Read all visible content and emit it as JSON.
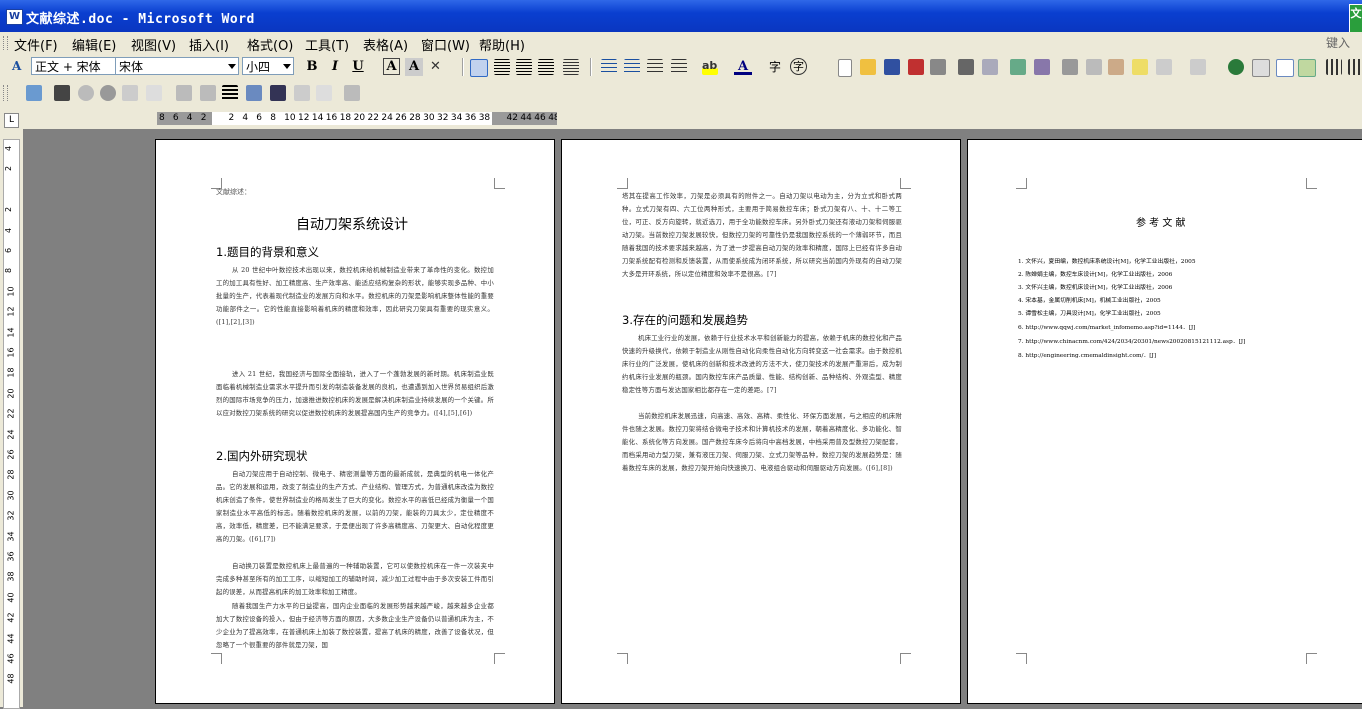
{
  "window": {
    "title": "文献综述.doc - Microsoft Word",
    "icon": "word-document-icon",
    "corner_button": "文"
  },
  "menu": {
    "items": [
      "文件(F)",
      "编辑(E)",
      "视图(V)",
      "插入(I)",
      "格式(O)",
      "工具(T)",
      "表格(A)",
      "窗口(W)",
      "帮助(H)"
    ],
    "hint": "键入"
  },
  "formatting": {
    "style": "正文 + 宋体",
    "font": "宋体",
    "size": "小四",
    "bold": "B",
    "italic": "I",
    "underline": "U",
    "char_border": "A",
    "font_color": "A",
    "phonetic": "字",
    "encircle": "字"
  },
  "ruler": {
    "marks": [
      "8",
      "6",
      "4",
      "2",
      "",
      "2",
      "4",
      "6",
      "8",
      "10",
      "12",
      "14",
      "16",
      "18",
      "20",
      "22",
      "24",
      "26",
      "28",
      "30",
      "32",
      "34",
      "36",
      "38",
      "",
      "42",
      "44",
      "46",
      "48"
    ],
    "tab_selector": "L",
    "vertical_marks": [
      "4",
      "2",
      "",
      "2",
      "4",
      "6",
      "8",
      "10",
      "12",
      "14",
      "16",
      "18",
      "20",
      "22",
      "24",
      "26",
      "28",
      "30",
      "32",
      "34",
      "36",
      "38",
      "40",
      "42",
      "44",
      "46",
      "48"
    ]
  },
  "page1": {
    "header": "文献综述：",
    "title": "自动刀架系统设计",
    "h1": "1.题目的背景和意义",
    "p1": "从 20 世纪中叶数控技术出现以来，数控机床给机械制造业带来了革命性的变化。数控加工的加工具有性好、加工精度高、生产效率高、能适应结构复杂的形状，能够实现多品种、中小批量的生产，代表着现代制造业的发展方向和水平。数控机床的刀架是影响机床整体性能的重要功能部件之一。它的性能直接影响着机床的精度和效率，因此研究刀架具有重要的现实意义。([1],[2],[3])",
    "p2": "进入 21 世纪，我国经济与国际全面接轨，进入了一个蓬勃发展的新时期。机床制造业既面临着机械制造业需求水平提升而引发的制造装备发展的良机，也遭遇到加入世界贸易组织后激烈的国际市场竞争的压力，加速推进数控机床的发展是解决机床制造业持续发展的一个关键。所以应对数控刀架系统的研究以促进数控机床的发展提高国内生产的竞争力。([4],[5],[6])",
    "h2": "2.国内外研究现状",
    "p3": "自动刀架应用于自动控制、微电子、精密测量等方面的最新成就，是典型的机电一体化产品。它的发展和运用，改变了制造业的生产方式、产业结构、管理方式，为普通机床改造为数控机床创造了条件，使世界制造业的格局发生了巨大的变化。数控水平的高低已经成为衡量一个国家制造业水平高低的标志。随着数控机床的发展，以前的刀架，能装的刀具太少，定位精度不高，效率低，精度差，已不能满足要求，于是便出现了许多高精度高、刀架更大、自动化程度更高的刀架。([6],[7])",
    "p4": "自动换刀装置是数控机床上最普遍的一种辅助装置，它可以使数控机床在一件一次装夹中完成多种甚至所有的加工工序，以缩短加工的辅助时间，减少加工过程中由于多次安装工件而引起的误差，从而提高机床的加工效率和加工精度。",
    "p5": "随着我国生产力水平的日益提高，国内企业面临的发展形势越来越严峻，越来越多企业都加大了数控设备的投入，但由于经济等方面的原因，大多数企业生产设备仍以普通机床为主，不少企业为了提高效率，在普通机床上加装了数控装置，提高了机床的精度，改善了设备状况，但忽略了一个很重要的部件就是刀架，国"
  },
  "page2": {
    "p1": "塔其在提高工作效率，刀架是必须具有的附件之一。自动刀架以电动为主，分为立式和卧式两种。立式刀架有四、六工位两种形式，主要用于简易数控车床；卧式刀架有八、十、十二等工位，可正、反方向旋转，就近选刀，用于全功能数控车床。另外卧式刀架还有液动刀架和伺服驱动刀架。当前数控刀架发展较快，但数控刀架的可靠性仍是我国数控系统的一个薄弱环节，而且随着我国的技术要求越来越高，为了进一步提高自动刀架的效率和精度，国际上已经有许多自动刀架系统配有检测和反馈装置，从而使系统成为闭环系统，所以研究当前国内外现有的自动刀架大多是开环系统，所以定位精度和效率不是很高。[7]",
    "h3": "3.存在的问题和发展趋势",
    "p2": "机床工业行业的发展，依赖于行业技术水平和创新能力的提高，依赖于机床的数控化和产品快速的升级换代，依赖于制造业从刚性自动化向柔性自动化方向转变这一社会需求。由于数控机床行业的广泛发展，使机床的创新和技术改进的方法不大，使刀架技术的发展严重滞后，成为制约机床行业发展的瓶颈。国内数控车床产品质量、性能、结构创新、品种结构、外观造型、精度稳定性等方面与发达国家相比都存在一定的差距。[7]",
    "p3": "当前数控机床发展迅速，向高速、高效、高精、柔性化、环保方面发展，与之相应的机床附件也随之发展。数控刀架将结合微电子技术和计算机技术的发展，朝着高精度化、多功能化、智能化、系统化等方向发展。国产数控车床今后将向中高档发展，中档采用普及型数控刀架配套，而档采用动力型刀架，兼有液压刀架、伺服刀架、立式刀架等品种，数控刀架的发展趋势是：随着数控车床的发展，数控刀架开始向快速换刀、电液组合驱动和伺服驱动方向发展。([6],[8])"
  },
  "page3": {
    "title": "参 考 文 献",
    "refs": [
      "1. 文怀兴，夏田编，数控机床系统设计[M]，化学工业出版社，2005",
      "2. 陈婵娟主编，数控车床设计[M]，化学工业出版社，2006",
      "3. 文怀兴主编，数控机床设计[M]，化学工业出版社，2006",
      "4. 宋本基，金属切削机床[M]，机械工业出版社，2005",
      "5. 谭雪松主编，刀具设计[M]，化学工业出版社，2005",
      "6. http://www.qqwj.com/market_infomemo.asp?id=1144．[J]",
      "7. http://www.chinacnm.com/424/2034/20301/news20020815121112.asp．[J]",
      "8. http://engineering.cmemaldinsight.com/．[J]"
    ]
  },
  "colors": {
    "title_bar": "#0a3fd0",
    "chrome": "#ece9d8",
    "workspace": "#808080"
  }
}
